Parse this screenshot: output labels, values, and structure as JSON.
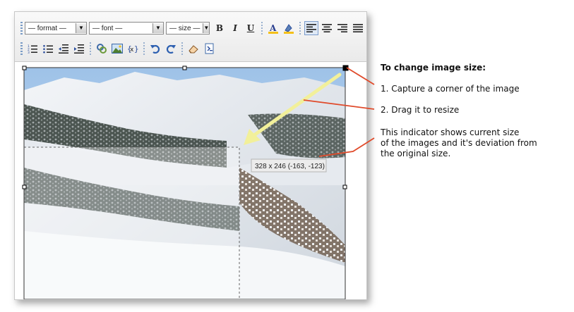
{
  "toolbar": {
    "format_select": "— format —",
    "font_select": "— font —",
    "size_select": "— size —",
    "bold": "B",
    "italic": "I",
    "underline": "U",
    "icons_row1": [
      "font-color-icon",
      "highlight-color-icon",
      "align-left-icon",
      "align-center-icon",
      "align-right-icon",
      "align-justify-icon"
    ],
    "icons_row2": [
      "numbered-list-icon",
      "bulleted-list-icon",
      "outdent-icon",
      "indent-icon",
      "link-icon",
      "image-icon",
      "html-source-icon",
      "undo-icon",
      "redo-icon",
      "eraser-icon",
      "template-icon"
    ]
  },
  "image": {
    "size_indicator": "328 x 246 (-163, -123)"
  },
  "notes": {
    "heading": "To change image size:",
    "step1": "1. Capture a corner of the image",
    "step2": "2. Drag it to resize",
    "indicator_line1": "This indicator shows current size",
    "indicator_line2": "of the images and it's deviation from",
    "indicator_line3": "the original size."
  },
  "colors": {
    "accent_blue": "#2c4f9e",
    "callout_red": "#e04a2a",
    "drag_arrow": "#f2f09a"
  }
}
